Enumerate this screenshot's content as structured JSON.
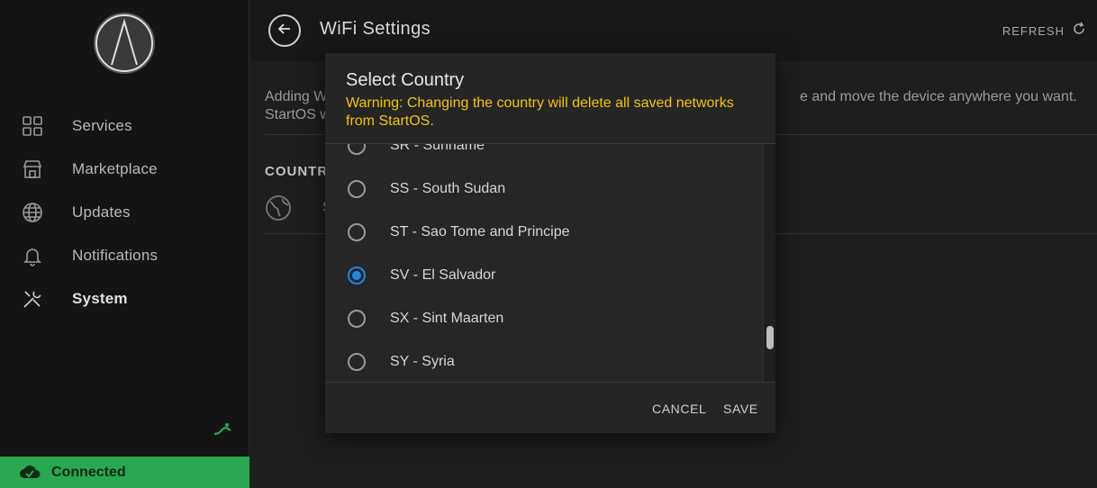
{
  "sidebar": {
    "items": [
      {
        "label": "Services",
        "icon": "grid-icon"
      },
      {
        "label": "Marketplace",
        "icon": "storefront-icon"
      },
      {
        "label": "Updates",
        "icon": "globe-icon"
      },
      {
        "label": "Notifications",
        "icon": "bell-icon"
      },
      {
        "label": "System",
        "icon": "tools-icon",
        "active": true
      }
    ],
    "status": "Connected"
  },
  "header": {
    "title": "WiFi Settings",
    "refresh_label": "REFRESH"
  },
  "content": {
    "text_line1_left": "Adding W",
    "text_line1_right": "e and move the device anywhere you want.",
    "text_line2": "StartOS w",
    "section_title": "COUNTR",
    "country_value_trunc": "S"
  },
  "modal": {
    "title": "Select Country",
    "warning": "Warning: Changing the country will delete all saved networks from StartOS.",
    "options": [
      {
        "label": "SR - Suriname",
        "checked": false
      },
      {
        "label": "SS - South Sudan",
        "checked": false
      },
      {
        "label": "ST - Sao Tome and Principe",
        "checked": false
      },
      {
        "label": "SV - El Salvador",
        "checked": true
      },
      {
        "label": "SX - Sint Maarten",
        "checked": false
      },
      {
        "label": "SY - Syria",
        "checked": false
      }
    ],
    "cancel_label": "CANCEL",
    "save_label": "SAVE"
  },
  "colors": {
    "accent": "#1e88e5",
    "warning": "#f1c40f",
    "connected": "#2aa751"
  }
}
